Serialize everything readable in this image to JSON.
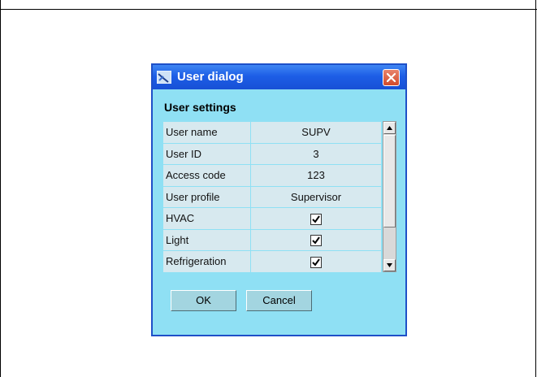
{
  "dialog": {
    "title": "User dialog",
    "section_title": "User settings",
    "rows": [
      {
        "label": "User name",
        "value": "SUPV",
        "type": "text"
      },
      {
        "label": "User ID",
        "value": "3",
        "type": "text"
      },
      {
        "label": "Access code",
        "value": "123",
        "type": "text"
      },
      {
        "label": "User profile",
        "value": "Supervisor",
        "type": "text"
      },
      {
        "label": "HVAC",
        "checked": true,
        "type": "checkbox"
      },
      {
        "label": "Light",
        "checked": true,
        "type": "checkbox"
      },
      {
        "label": "Refrigeration",
        "checked": true,
        "type": "checkbox"
      }
    ],
    "buttons": {
      "ok": "OK",
      "cancel": "Cancel"
    }
  },
  "colors": {
    "titlebar": "#1d5ee6",
    "dialog_bg": "#8fe0f4",
    "cell_bg": "#d7e9ef",
    "close_button": "#d24a2b"
  },
  "icons": {
    "app": "user-dialog-app-icon",
    "close": "close-icon",
    "scroll_up": "scroll-up-arrow-icon",
    "scroll_down": "scroll-down-arrow-icon",
    "check": "checkmark-icon"
  }
}
